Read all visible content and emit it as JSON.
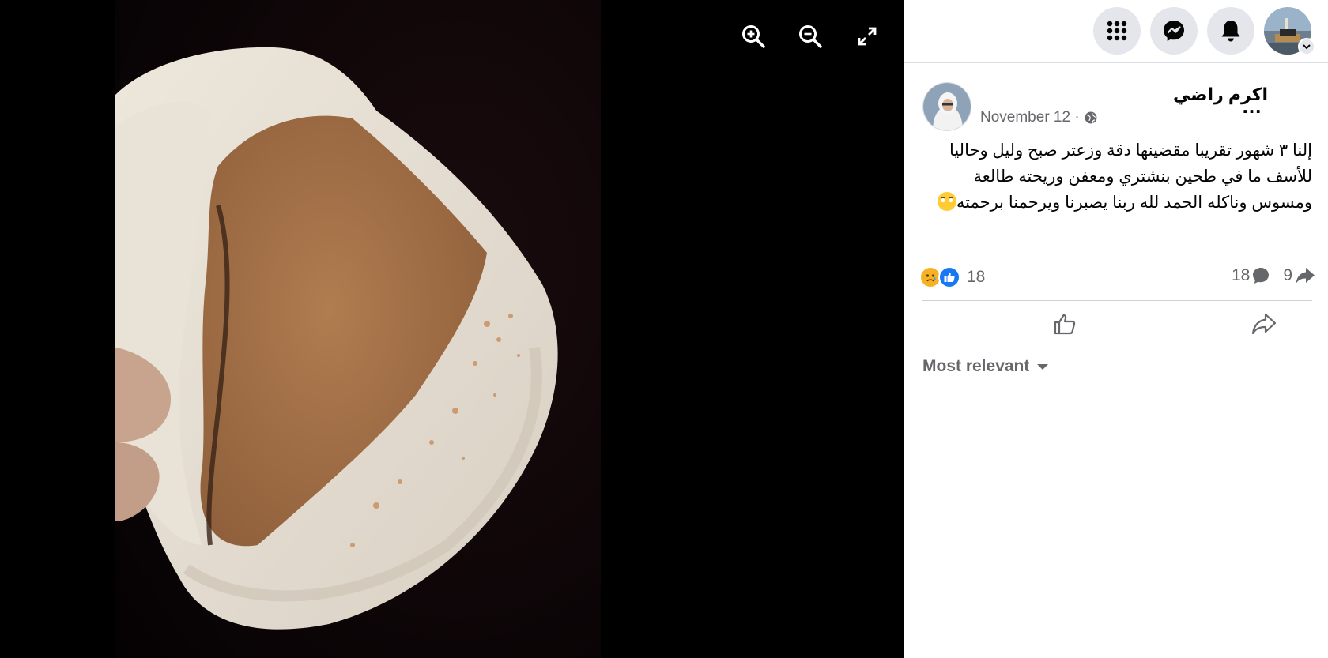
{
  "viewer": {
    "tools": [
      {
        "icon": "zoom-in-icon"
      },
      {
        "icon": "zoom-out-icon"
      },
      {
        "icon": "fullscreen-icon"
      }
    ]
  },
  "nav": {
    "icons": [
      "menu-grid-icon",
      "messenger-icon",
      "bell-icon",
      "profile-avatar",
      "chevron-down-icon"
    ]
  },
  "post": {
    "author": "اكرم راضي",
    "more_label": "...",
    "date": "November 12",
    "separator": " · ",
    "privacy_icon": "globe-icon",
    "text": "إلنا ٣ شهور تقريبا مقضينها دقة وزعتر صبح وليل وحاليا للأسف ما في طحين بنشتري ومعفن وريحته طالعة ومسوس وناكله الحمد لله ربنا يصبرنا ويرحمنا برحمته",
    "text_emoji": "rolling-eyes-emoji"
  },
  "stats": {
    "reaction_icons": [
      "sad-reaction-icon",
      "like-reaction-icon"
    ],
    "reactions_count": "18",
    "comments_count": "18",
    "shares_count": "9"
  },
  "actions": {
    "icons": [
      "like-icon",
      "share-icon"
    ]
  },
  "comments": {
    "sort_label": "Most relevant"
  },
  "colors": {
    "like_blue": "#1877f2",
    "secondary_text": "#65676b",
    "nav_circle": "#e4e6eb",
    "viewer_bg": "#000000"
  }
}
